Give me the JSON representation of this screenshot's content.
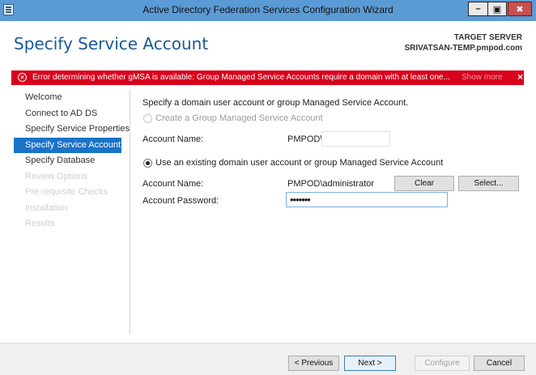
{
  "window": {
    "title": "Active Directory Federation Services Configuration Wizard",
    "minimize_glyph": "–",
    "maximize_glyph": "▣",
    "close_glyph": "✖"
  },
  "header": {
    "title": "Specify Service Account",
    "target_label": "TARGET SERVER",
    "target_value": "SRIVATSAN-TEMP.pmpod.com"
  },
  "error_banner": {
    "icon_glyph": "×",
    "message": "Error determining whether gMSA is available: Group Managed Service Accounts require a domain with at least one...",
    "show_more": "Show more",
    "close_glyph": "×",
    "color": "#d9001b"
  },
  "sidebar": {
    "items": [
      {
        "label": "Welcome",
        "state": "normal"
      },
      {
        "label": "Connect to AD DS",
        "state": "normal"
      },
      {
        "label": "Specify Service Properties",
        "state": "normal"
      },
      {
        "label": "Specify Service Account",
        "state": "active"
      },
      {
        "label": "Specify Database",
        "state": "normal"
      },
      {
        "label": "Review Options",
        "state": "disabled"
      },
      {
        "label": "Pre-requisite Checks",
        "state": "disabled"
      },
      {
        "label": "Installation",
        "state": "disabled"
      },
      {
        "label": "Results",
        "state": "disabled"
      }
    ],
    "accent_color": "#1a73c6"
  },
  "main": {
    "instructions": "Specify a domain user account or group Managed Service Account.",
    "option_gmsa": {
      "label": "Create a Group Managed Service Account",
      "selected": false,
      "enabled": false,
      "account_name_label": "Account Name:",
      "domain_prefix": "PMPOD\\",
      "account_value": ""
    },
    "option_existing": {
      "label": "Use an existing domain user account or group Managed Service Account",
      "selected": true,
      "account_name_label": "Account Name:",
      "account_name_value": "PMPOD\\administrator",
      "clear_button": "Clear",
      "select_button": "Select...",
      "password_label": "Account Password:",
      "password_value": "•••••••"
    }
  },
  "footer": {
    "previous_button": "< Previous",
    "next_button": "Next >",
    "configure_button": "Configure",
    "cancel_button": "Cancel"
  }
}
